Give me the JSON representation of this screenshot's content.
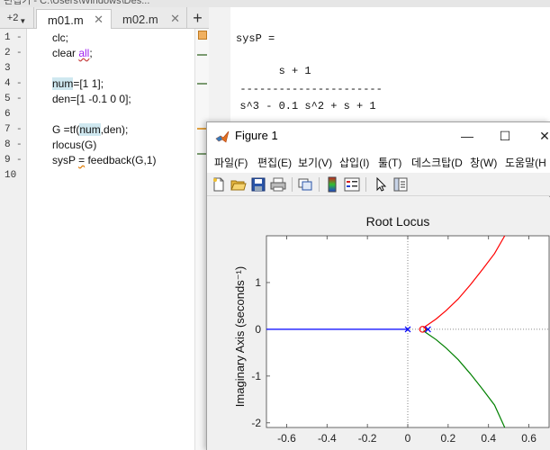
{
  "editor": {
    "title_fragment": "편집기 - C:\\Users\\Windows\\Des...",
    "tab_scroll_label": "+2",
    "tabs": [
      {
        "label": "m01.m",
        "close": "✕",
        "active": true
      },
      {
        "label": "m02.m",
        "close": "✕",
        "active": false
      }
    ],
    "new_tab": "+",
    "lines": [
      {
        "n": "1",
        "dash": "-"
      },
      {
        "n": "2",
        "dash": "-"
      },
      {
        "n": "3",
        "dash": ""
      },
      {
        "n": "4",
        "dash": "-"
      },
      {
        "n": "5",
        "dash": "-"
      },
      {
        "n": "6",
        "dash": ""
      },
      {
        "n": "7",
        "dash": "-"
      },
      {
        "n": "8",
        "dash": "-"
      },
      {
        "n": "9",
        "dash": "-"
      },
      {
        "n": "10",
        "dash": ""
      }
    ],
    "code": {
      "l1": "clc;",
      "l2_a": "clear ",
      "l2_b": "all",
      "l2_c": ";",
      "l4_a": "num",
      "l4_b": "=[1 1];",
      "l5": "den=[1 -0.1 0 0];",
      "l7_a": "G =tf(",
      "l7_b": "num",
      "l7_c": ",den);",
      "l8": "rlocus(G)",
      "l9_a": "sysP ",
      "l9_b": "=",
      "l9_c": " feedback(G,1)"
    }
  },
  "command_window": {
    "line1": "sysP =",
    "numerator": "        s + 1",
    "divider": "  ----------------------",
    "denominator": "  s^3 - 0.1 s^2 + s + 1"
  },
  "figure": {
    "title": "Figure 1",
    "controls": {
      "minimize": "—",
      "maximize": "☐",
      "close": "✕"
    },
    "menus": [
      "파일(F)",
      "편집(E)",
      "보기(V)",
      "삽입(I)",
      "툴(T)",
      "데스크탑(D",
      "창(W)",
      "도움말(H"
    ],
    "toolbar_icons": [
      "new-figure-icon",
      "open-file-icon",
      "save-icon",
      "print-icon",
      "link-plot-icon",
      "colorbar-icon",
      "legend-icon",
      "pointer-icon",
      "property-editor-icon"
    ]
  },
  "chart_data": {
    "type": "line",
    "title": "Root Locus",
    "ylabel": "Imaginary Axis (seconds⁻¹)",
    "xlabel": "",
    "xlim": [
      -0.7,
      0.7
    ],
    "ylim": [
      -2.1,
      2.0
    ],
    "xticks": [
      "-0.6",
      "-0.4",
      "-0.2",
      "0",
      "0.2",
      "0.4",
      "0.6"
    ],
    "xtick_values": [
      -0.6,
      -0.4,
      -0.2,
      0,
      0.2,
      0.4,
      0.6
    ],
    "yticks": [
      "1",
      "0",
      "-1",
      "-2"
    ],
    "ytick_values": [
      1,
      0,
      -1,
      -2
    ],
    "grid": false,
    "zero_lines": "dotted",
    "series": [
      {
        "color": "#0000ff",
        "x": [
          -0.7,
          -0.5,
          -0.3,
          -0.1,
          0
        ],
        "y": [
          0,
          0,
          0,
          0,
          0
        ]
      },
      {
        "color": "#ff0000",
        "x": [
          0.1,
          0.09,
          0.08,
          0.1,
          0.14,
          0.19,
          0.25,
          0.31,
          0.37,
          0.43,
          0.48
        ],
        "y": [
          0,
          0.01,
          0.04,
          0.1,
          0.22,
          0.4,
          0.65,
          0.95,
          1.28,
          1.62,
          2.0
        ]
      },
      {
        "color": "#008000",
        "x": [
          0.1,
          0.09,
          0.08,
          0.1,
          0.14,
          0.19,
          0.25,
          0.31,
          0.37,
          0.43,
          0.48
        ],
        "y": [
          0,
          -0.01,
          -0.04,
          -0.1,
          -0.22,
          -0.4,
          -0.65,
          -0.95,
          -1.28,
          -1.62,
          -2.1
        ]
      }
    ],
    "poles": {
      "x": [
        0,
        0.1
      ],
      "y": [
        0,
        0
      ],
      "marker": "x",
      "color": "#0000ff"
    },
    "zeros": {
      "x": [
        0.1
      ],
      "y": [
        0
      ],
      "marker": "o",
      "color": "#ff0000"
    }
  }
}
